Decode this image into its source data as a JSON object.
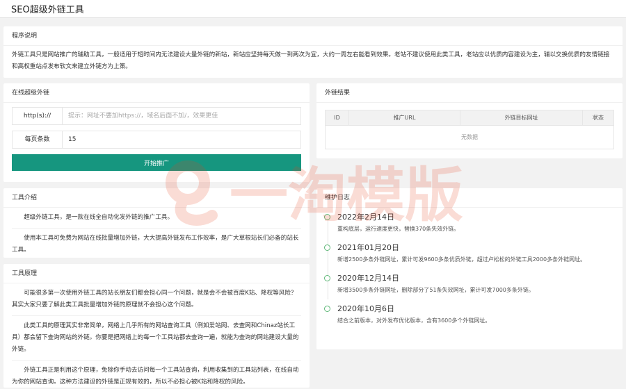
{
  "page": {
    "title": "SEO超级外链工具"
  },
  "program": {
    "title": "程序说明",
    "text": "外链工具只是网站推广的辅助工具，一般适用于短时间内无法建设大量外链的新站，新站应坚持每天做一到两次为宜，大约一周左右能看到效果。老站不建议使用此类工具，老站应以优质内容建设为主，辅以交换优质的友情链接和高权重站点发布软文来建立外链方为上策。"
  },
  "online": {
    "title": "在线超级外链",
    "url_label": "http(s)://",
    "url_placeholder": "提示：网址不要加https://，域名后面不加/，效果更佳",
    "per_page_label": "每页条数",
    "per_page_value": "15",
    "submit_label": "开始推广"
  },
  "results": {
    "title": "外链结果",
    "columns": [
      "ID",
      "推广URL",
      "外链目标网址",
      "状态"
    ],
    "empty_text": "无数据"
  },
  "intro": {
    "title": "工具介绍",
    "paragraphs": [
      "超级外链工具，是一款在线全自动化发外链的推广工具。",
      "使用本工具可免费为网站在线批量增加外链，大大提高外链发布工作效率，是广大草根站长们必备的站长工具。"
    ]
  },
  "principle": {
    "title": "工具原理",
    "paragraphs": [
      "可能很多第一次使用外链工具的站长朋友们都会担心同一个问题，就是会不会被百度K站、降权等风险？其实大家只要了解此类工具批量增加外链的原理就不会担心这个问题。",
      "此类工具的原理其实非常简单，网络上几乎所有的网站查询工具（例如爱站网、去查网和Chinaz站长工具）都会留下查询网站的外链。你要是把网络上的每一个工具站都去查询一遍，就能为查询的网站建设大量的外链。",
      "外链工具正是利用这个原理，免除你手动去访问每一个工具站查询，利用收集到的工具站列表，在线自动为你的网站查询。这种方法建设的外链是正规有效的，所以不必担心被K站和降权的风险。"
    ]
  },
  "log": {
    "title": "维护日志",
    "items": [
      {
        "date": "2022年2月14日",
        "text": "重构底层，运行速度更快，替换370条失效外链。"
      },
      {
        "date": "2021年01月20日",
        "text": "新增2500多条外链网址，累计可发9600多条优质外链，超过卢松松的外链工具2000多条外链网址。"
      },
      {
        "date": "2020年12月14日",
        "text": "新增3500多条外链网址，删除部分了51条失效网址，累计可发7000多条外链。"
      },
      {
        "date": "2020年10月6日",
        "text": "结合之前版本，对外发布优化版本，含有3600多个外链网址。"
      }
    ]
  },
  "watermark": {
    "text": "一淘模版",
    "color": "#e8411f"
  }
}
